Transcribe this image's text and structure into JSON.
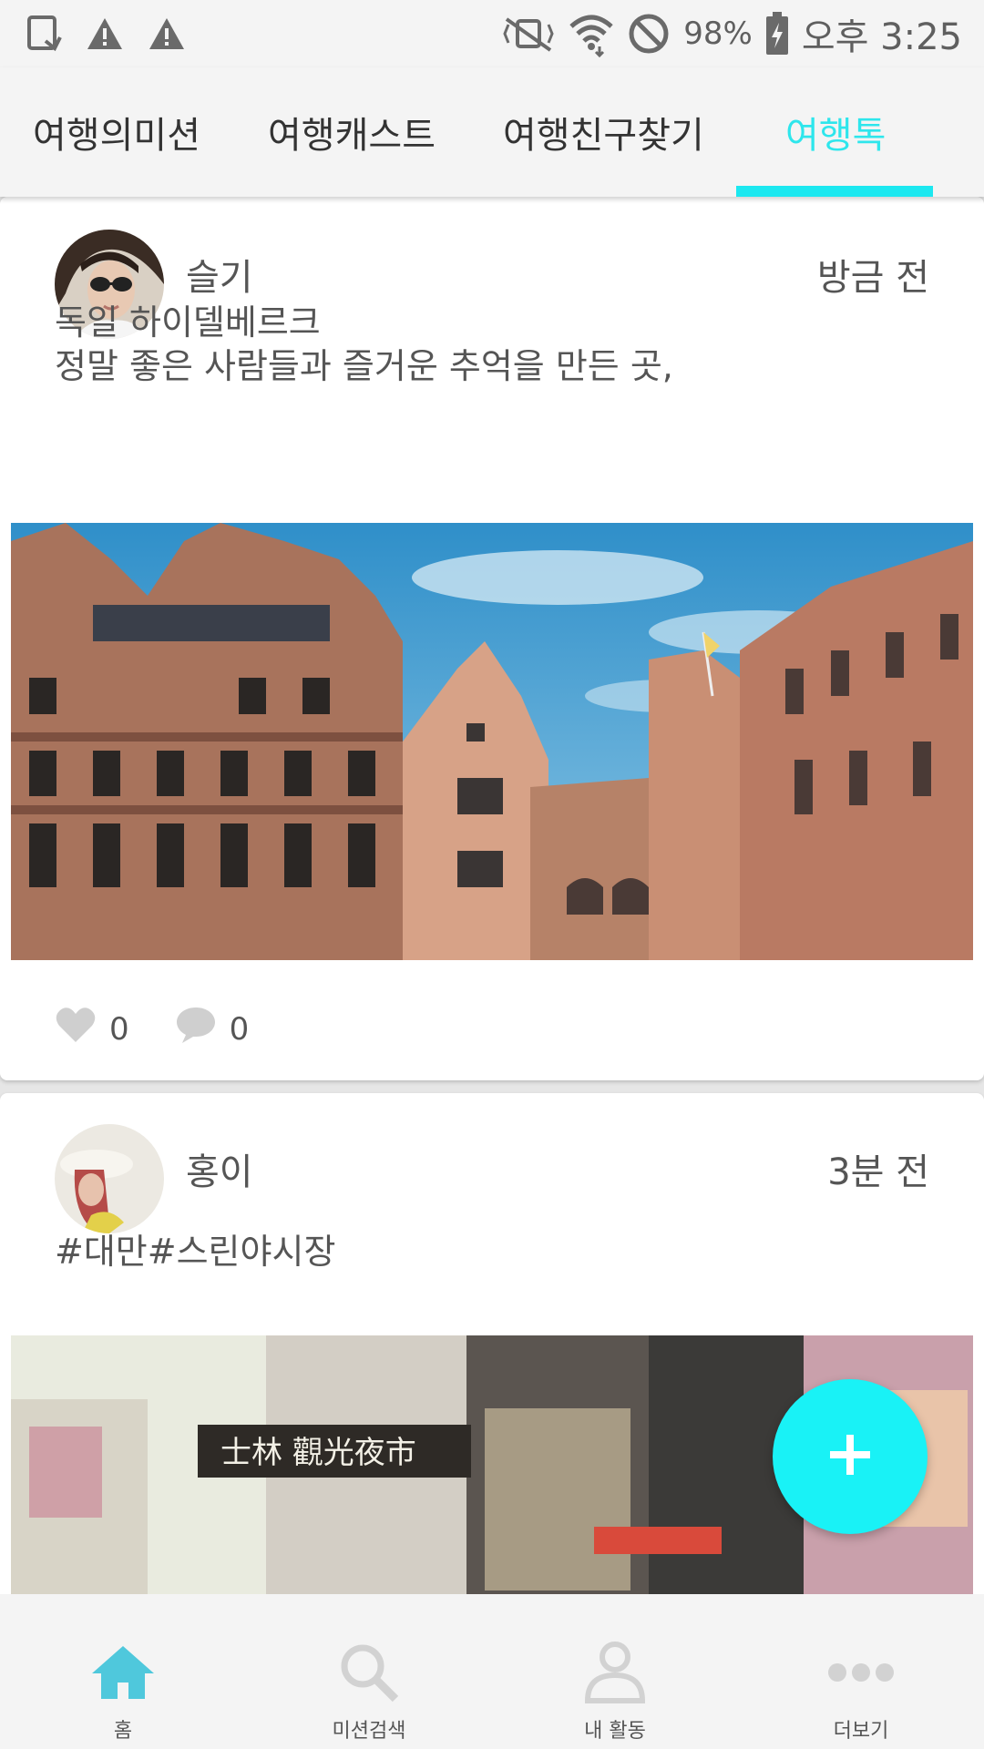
{
  "status_bar": {
    "battery_percent": "98%",
    "time": "오후 3:25",
    "icons": [
      "screen-rotate-icon",
      "warning-icon",
      "warning-icon",
      "vibrate-mute-icon",
      "wifi-icon",
      "do-not-disturb-icon",
      "battery-charging-icon"
    ]
  },
  "tabs": [
    {
      "label": "여행의미션",
      "active": false
    },
    {
      "label": "여행캐스트",
      "active": false
    },
    {
      "label": "여행친구찾기",
      "active": false
    },
    {
      "label": "여행톡",
      "active": true
    }
  ],
  "posts": [
    {
      "username": "슬기",
      "time": "방금 전",
      "text_lines": [
        "독일 하이델베르크",
        "정말 좋은 사람들과 즐거운 추억을 만든 곳,"
      ],
      "likes": "0",
      "comments": "0"
    },
    {
      "username": "홍이",
      "time": "3분 전",
      "text_lines": [
        "#대만#스린야시장"
      ],
      "sign_text": "士林 觀光夜市"
    }
  ],
  "bottom_nav": [
    {
      "label": "홈",
      "icon": "home-icon",
      "active": true
    },
    {
      "label": "미션검색",
      "icon": "search-icon",
      "active": false
    },
    {
      "label": "내 활동",
      "icon": "person-icon",
      "active": false
    },
    {
      "label": "더보기",
      "icon": "more-icon",
      "active": false
    }
  ],
  "colors": {
    "accent": "#1CE8F0",
    "fab": "#19F2F6",
    "text": "#555555"
  }
}
